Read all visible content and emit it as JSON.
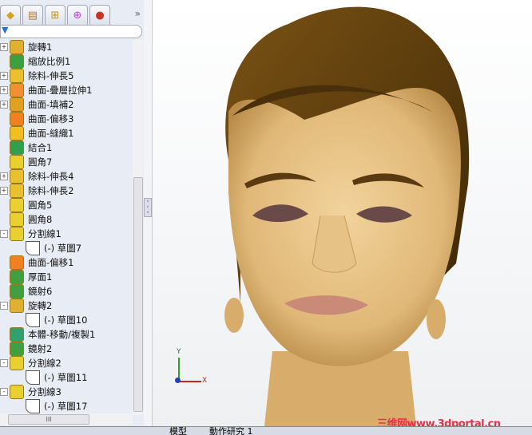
{
  "panel": {
    "tabs": [
      "feature-manager",
      "property-manager",
      "configuration-manager",
      "dimxpert-manager",
      "display-manager"
    ],
    "more": "»",
    "tree": [
      {
        "label": "旋轉1",
        "expand": "+",
        "indent": 0,
        "icon": "revolve",
        "color": "#e0b030"
      },
      {
        "label": "縮放比例1",
        "expand": "",
        "indent": 0,
        "icon": "scale",
        "color": "#3aa040"
      },
      {
        "label": "除料-伸長5",
        "expand": "+",
        "indent": 0,
        "icon": "cut-extrude",
        "color": "#e8c030"
      },
      {
        "label": "曲面-疊層拉伸1",
        "expand": "+",
        "indent": 0,
        "icon": "surface-loft",
        "color": "#f09030"
      },
      {
        "label": "曲面-填補2",
        "expand": "+",
        "indent": 0,
        "icon": "surface-fill",
        "color": "#e0a020"
      },
      {
        "label": "曲面-偏移3",
        "expand": "",
        "indent": 0,
        "icon": "surface-offset",
        "color": "#f08020"
      },
      {
        "label": "曲面-縫織1",
        "expand": "",
        "indent": 0,
        "icon": "surface-knit",
        "color": "#f0c020"
      },
      {
        "label": "結合1",
        "expand": "",
        "indent": 0,
        "icon": "combine",
        "color": "#30a050"
      },
      {
        "label": "圓角7",
        "expand": "",
        "indent": 0,
        "icon": "fillet",
        "color": "#e8d030"
      },
      {
        "label": "除料-伸長4",
        "expand": "+",
        "indent": 0,
        "icon": "cut-extrude",
        "color": "#e8c030"
      },
      {
        "label": "除料-伸長2",
        "expand": "+",
        "indent": 0,
        "icon": "cut-extrude",
        "color": "#e8c030"
      },
      {
        "label": "圓角5",
        "expand": "",
        "indent": 0,
        "icon": "fillet",
        "color": "#e8d030"
      },
      {
        "label": "圓角8",
        "expand": "",
        "indent": 0,
        "icon": "fillet",
        "color": "#e8d030"
      },
      {
        "label": "分割線1",
        "expand": "−",
        "indent": 0,
        "icon": "split-line",
        "color": "#e8d030"
      },
      {
        "label": "(-) 草圖7",
        "expand": "",
        "indent": 1,
        "icon": "sketch",
        "color": "#ffffff"
      },
      {
        "label": "曲面-偏移1",
        "expand": "",
        "indent": 0,
        "icon": "surface-offset",
        "color": "#f08020"
      },
      {
        "label": "厚面1",
        "expand": "",
        "indent": 0,
        "icon": "thicken",
        "color": "#40a040"
      },
      {
        "label": "鏡射6",
        "expand": "",
        "indent": 0,
        "icon": "mirror",
        "color": "#40a040"
      },
      {
        "label": "旋轉2",
        "expand": "−",
        "indent": 0,
        "icon": "revolve",
        "color": "#e0b030"
      },
      {
        "label": "(-) 草圖10",
        "expand": "",
        "indent": 1,
        "icon": "sketch",
        "color": "#ffffff"
      },
      {
        "label": "本體-移動/複製1",
        "expand": "",
        "indent": 0,
        "icon": "move-copy",
        "color": "#30a070"
      },
      {
        "label": "鏡射2",
        "expand": "",
        "indent": 0,
        "icon": "mirror",
        "color": "#40a040"
      },
      {
        "label": "分割線2",
        "expand": "−",
        "indent": 0,
        "icon": "split-line",
        "color": "#e8d030"
      },
      {
        "label": "(-) 草圖11",
        "expand": "",
        "indent": 1,
        "icon": "sketch",
        "color": "#ffffff"
      },
      {
        "label": "分割線3",
        "expand": "−",
        "indent": 0,
        "icon": "split-line",
        "color": "#e8d030"
      },
      {
        "label": "(-) 草圖17",
        "expand": "",
        "indent": 1,
        "icon": "sketch",
        "color": "#ffffff"
      }
    ],
    "hscroll_grip": "III"
  },
  "bottom_tabs": [
    "模型",
    "動作研究 1"
  ],
  "triad": {
    "x": "X",
    "y": "Y"
  },
  "watermark": "三维网www.3dportal.cn",
  "colors": {
    "hair": "#5a3a0c",
    "skin": "#e8c48a",
    "lips": "#c98a78"
  }
}
